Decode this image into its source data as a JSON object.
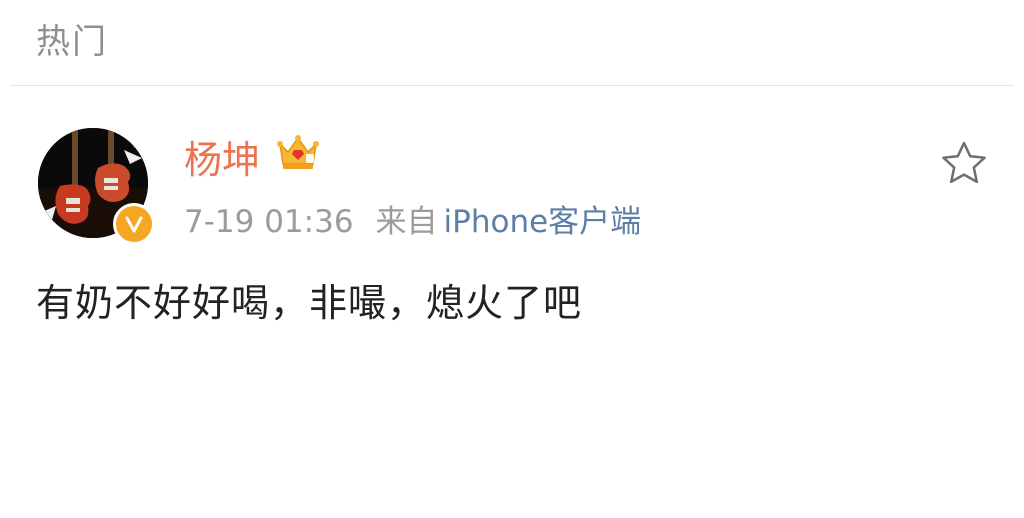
{
  "section": {
    "title": "热门"
  },
  "post": {
    "username": "杨坤",
    "time": "7-19 01:36",
    "from_label": "来自",
    "source": "iPhone客户端",
    "content": "有奶不好好喝，非嘬，熄火了吧"
  },
  "icons": {
    "crown": "vip-crown-icon",
    "verified": "verified-v-badge-icon",
    "star": "favorite-star-icon"
  },
  "colors": {
    "username": "#eb7350",
    "source_link": "#5d7fa6",
    "meta_text": "#9b9b9b",
    "header_text": "#8f8f8f",
    "verified_badge": "#f5a623"
  }
}
